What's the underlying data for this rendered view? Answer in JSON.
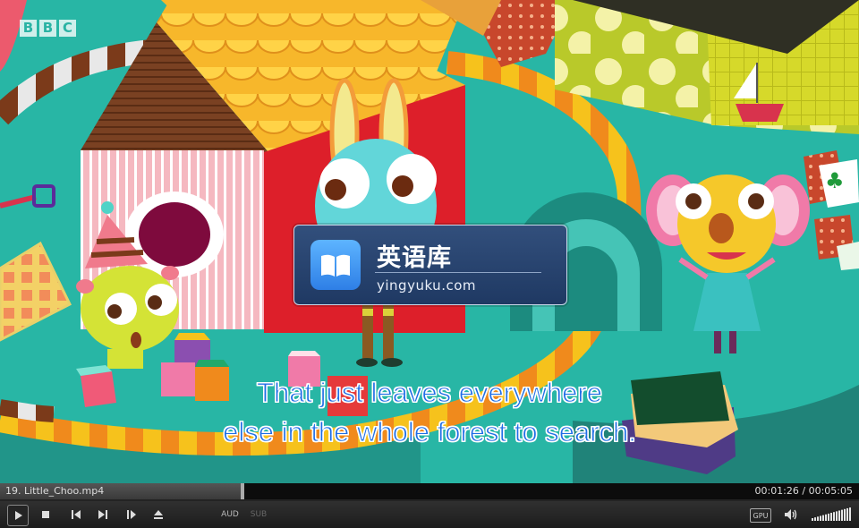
{
  "window": {
    "type": "media-player"
  },
  "video": {
    "channel_logo": [
      "B",
      "B",
      "C"
    ],
    "watermark": {
      "title": "英语库",
      "url": "yingyuku.com"
    },
    "subtitles": [
      "That just leaves everywhere",
      "else in the whole forest to search."
    ]
  },
  "player": {
    "filename": "19. Little_Choo.mp4",
    "time": "00:01:26 / 00:05:05",
    "progress": 0.282,
    "buttons": {
      "audio": "AUD",
      "subtitle": "SUB",
      "gpu": "GPU"
    },
    "volume_level": 1.0,
    "icons": [
      "play-icon",
      "stop-icon",
      "previous-icon",
      "next-icon",
      "frame-step-icon",
      "eject-icon",
      "volume-icon"
    ],
    "colors": {
      "subtitle_text": "#1f6ee6",
      "progress_fill": "#4a4a4a"
    }
  }
}
